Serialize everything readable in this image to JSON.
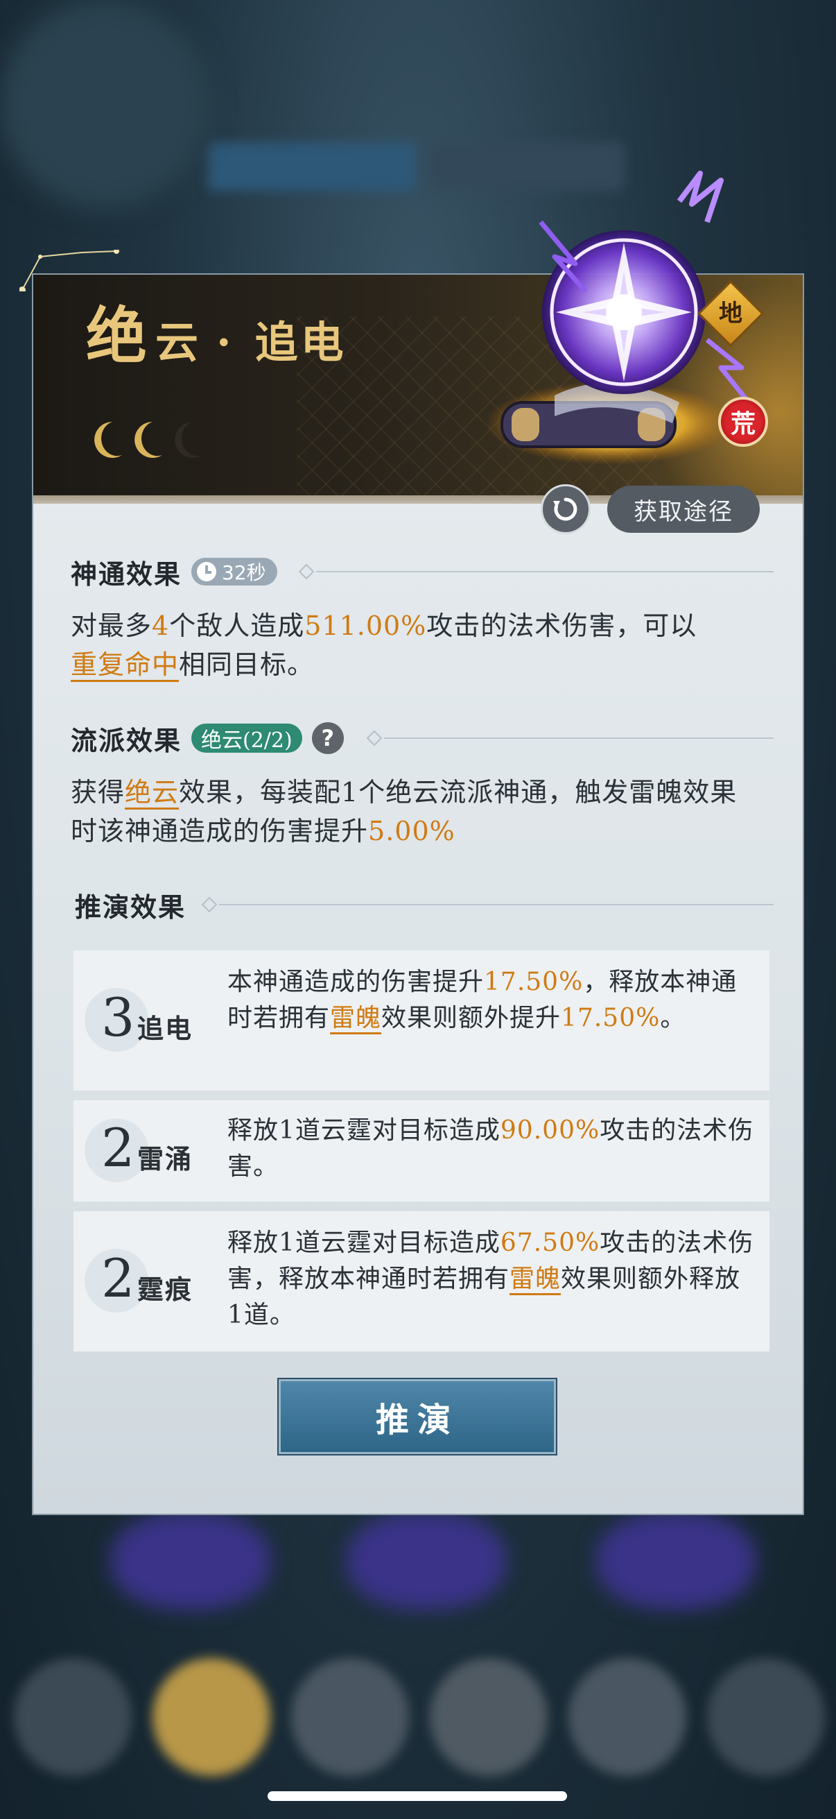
{
  "skill": {
    "title_main": "绝",
    "title_sub": "云",
    "title_dot": "·",
    "title_name": "追电",
    "rank_badge": "地",
    "grade_badge": "荒",
    "star_moons": 3,
    "filled_moons": 2
  },
  "actions": {
    "acquire_label": "获取途径"
  },
  "divine_effect": {
    "heading": "神通效果",
    "cooldown": "32秒",
    "text_parts": [
      "对最多",
      "4",
      "个敌人造成",
      "511.00%",
      "攻击的法术伤害，可以"
    ],
    "link": "重复命中",
    "text_end": "相同目标。"
  },
  "school_effect": {
    "heading": "流派效果",
    "school_pill": "绝云(2/2)",
    "help_label": "?",
    "text_a": "获得",
    "link": "绝云",
    "text_b": "效果，每装配1个绝云流派神通，触发雷魄效果时该神通造成的伤害提升",
    "value": "5.00%"
  },
  "deduction": {
    "heading": "推演效果",
    "rows": [
      {
        "level": "3",
        "name": "追电",
        "t1": "本神通造成的伤害提升",
        "v1": "17.50%",
        "t2": "，释放本神通时若拥有",
        "link": "雷魄",
        "t3": "效果则额外提升",
        "v2": "17.50%",
        "t4": "。"
      },
      {
        "level": "2",
        "name": "雷涌",
        "t1": "释放1道云霆对目标造成",
        "v1": "90.00%",
        "t2": "攻击的法术伤害。"
      },
      {
        "level": "2",
        "name": "霆痕",
        "t1": "释放1道云霆对目标造成",
        "v1": "67.50%",
        "t2": "攻击的法术伤害，释放本神通时若拥有",
        "link": "雷魄",
        "t3": "效果则额外释放1道。"
      }
    ]
  },
  "deduce_button": "推演",
  "colors": {
    "accent_orange": "#d07a12",
    "school_green": "#2e8a72",
    "title_gold": "#e8c77c",
    "button_blue": "#3a7398"
  }
}
